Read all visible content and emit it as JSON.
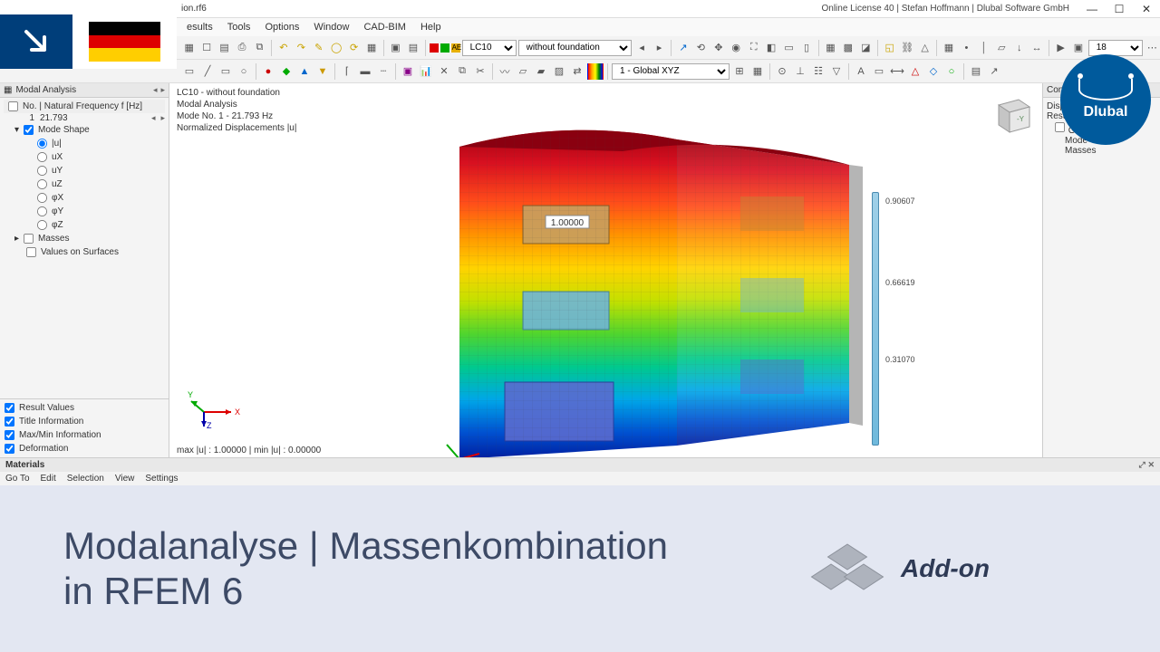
{
  "titlebar": {
    "filename": "ion.rf6",
    "license": "Online License 40 | Stefan Hoffmann | Dlubal Software GmbH"
  },
  "menubar": [
    "esults",
    "Tools",
    "Options",
    "Window",
    "CAD-BIM",
    "Help"
  ],
  "toolbar": {
    "lc_label": "LC10",
    "lc_desc": "without foundation",
    "coord_system": "1 - Global XYZ",
    "layer": "AE",
    "layer_num": "18"
  },
  "left": {
    "panel_title": "Modal Analysis",
    "columns": "No. | Natural Frequency f [Hz]",
    "freq": {
      "no": "1",
      "value": "21.793"
    },
    "mode_shape": "Mode Shape",
    "components": [
      "|u|",
      "uX",
      "uY",
      "uZ",
      "φX",
      "φY",
      "φZ"
    ],
    "masses": "Masses",
    "values_on_surfaces": "Values on Surfaces",
    "checks": [
      "Result Values",
      "Title Information",
      "Max/Min Information",
      "Deformation"
    ]
  },
  "viewport": {
    "line1": "LC10 - without foundation",
    "line2": "Modal Analysis",
    "line3": "Mode No. 1 - 21.793 Hz",
    "line4": "Normalized Displacements |u|",
    "status": "max |u| : 1.00000 | min |u| : 0.00000",
    "center_label": "1.00000",
    "beam_labels": [
      "0.90607",
      "0.66619",
      "0.31070"
    ],
    "axis_x": "X",
    "axis_y": "Y",
    "axis_z": "Z",
    "cube_face": "-Y"
  },
  "right": {
    "header": "Control Pan",
    "l1": "Display Fa",
    "l2": "Results",
    "l3": "General",
    "l4": "Mode",
    "l5": "Masses"
  },
  "bottom": {
    "materials": "Materials",
    "menu": [
      "Go To",
      "Edit",
      "Selection",
      "View",
      "Settings"
    ]
  },
  "banner": {
    "title_l1": "Modalanalyse | Massenkombination",
    "title_l2": "in RFEM 6",
    "addon": "Add-on",
    "logo": "Dlubal"
  }
}
